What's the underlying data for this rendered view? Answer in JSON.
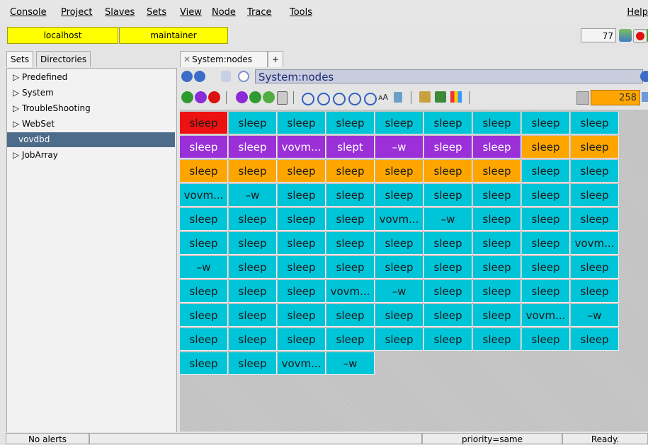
{
  "menu": {
    "items": [
      "Console",
      "Project",
      "Slaves",
      "Sets",
      "View",
      "Node",
      "Trace",
      "Tools"
    ],
    "help": "Help"
  },
  "infobar": {
    "host": "localhost",
    "user": "maintainer",
    "count": "77",
    "icons": [
      "monitor-icon",
      "stop-icon",
      "train-icon"
    ]
  },
  "left_panel": {
    "tabs": [
      "Sets",
      "Directories"
    ],
    "active_tab": "Sets",
    "tree": [
      {
        "label": "▷ Predefined",
        "selected": false
      },
      {
        "label": "▷ System",
        "selected": false
      },
      {
        "label": "▷ TroubleShooting",
        "selected": false
      },
      {
        "label": "▷ WebSet",
        "selected": false
      },
      {
        "label": "vovdbd",
        "selected": true
      },
      {
        "label": "▷ JobArray",
        "selected": false
      }
    ]
  },
  "right_panel": {
    "tab_close": "✕",
    "tab_label": "System:nodes",
    "tab_add": "+",
    "path": "System:nodes",
    "node_count": "258"
  },
  "colors": {
    "red": "#ee1111",
    "purple": "#9b30d9",
    "orange": "#ffa500",
    "cyan": "#00c4d8"
  },
  "grid": {
    "columns": 9,
    "cells": [
      {
        "text": "sleep",
        "color": "red"
      },
      {
        "text": "sleep",
        "color": "cyan"
      },
      {
        "text": "sleep",
        "color": "cyan"
      },
      {
        "text": "sleep",
        "color": "cyan"
      },
      {
        "text": "sleep",
        "color": "cyan"
      },
      {
        "text": "sleep",
        "color": "cyan"
      },
      {
        "text": "sleep",
        "color": "cyan"
      },
      {
        "text": "sleep",
        "color": "cyan"
      },
      {
        "text": "sleep",
        "color": "cyan"
      },
      {
        "text": "sleep",
        "color": "purple"
      },
      {
        "text": "sleep",
        "color": "purple"
      },
      {
        "text": "vovm...",
        "color": "purple"
      },
      {
        "text": "slept",
        "color": "purple"
      },
      {
        "text": "–w",
        "color": "purple"
      },
      {
        "text": "sleep",
        "color": "purple"
      },
      {
        "text": "sleep",
        "color": "purple"
      },
      {
        "text": "sleep",
        "color": "orange"
      },
      {
        "text": "sleep",
        "color": "orange"
      },
      {
        "text": "sleep",
        "color": "orange"
      },
      {
        "text": "sleep",
        "color": "orange"
      },
      {
        "text": "sleep",
        "color": "orange"
      },
      {
        "text": "sleep",
        "color": "orange"
      },
      {
        "text": "sleep",
        "color": "orange"
      },
      {
        "text": "sleep",
        "color": "orange"
      },
      {
        "text": "sleep",
        "color": "orange"
      },
      {
        "text": "sleep",
        "color": "cyan"
      },
      {
        "text": "sleep",
        "color": "cyan"
      },
      {
        "text": "vovm...",
        "color": "cyan"
      },
      {
        "text": "–w",
        "color": "cyan"
      },
      {
        "text": "sleep",
        "color": "cyan"
      },
      {
        "text": "sleep",
        "color": "cyan"
      },
      {
        "text": "sleep",
        "color": "cyan"
      },
      {
        "text": "sleep",
        "color": "cyan"
      },
      {
        "text": "sleep",
        "color": "cyan"
      },
      {
        "text": "sleep",
        "color": "cyan"
      },
      {
        "text": "sleep",
        "color": "cyan"
      },
      {
        "text": "sleep",
        "color": "cyan"
      },
      {
        "text": "sleep",
        "color": "cyan"
      },
      {
        "text": "sleep",
        "color": "cyan"
      },
      {
        "text": "sleep",
        "color": "cyan"
      },
      {
        "text": "vovm...",
        "color": "cyan"
      },
      {
        "text": "–w",
        "color": "cyan"
      },
      {
        "text": "sleep",
        "color": "cyan"
      },
      {
        "text": "sleep",
        "color": "cyan"
      },
      {
        "text": "sleep",
        "color": "cyan"
      },
      {
        "text": "sleep",
        "color": "cyan"
      },
      {
        "text": "sleep",
        "color": "cyan"
      },
      {
        "text": "sleep",
        "color": "cyan"
      },
      {
        "text": "sleep",
        "color": "cyan"
      },
      {
        "text": "sleep",
        "color": "cyan"
      },
      {
        "text": "sleep",
        "color": "cyan"
      },
      {
        "text": "sleep",
        "color": "cyan"
      },
      {
        "text": "sleep",
        "color": "cyan"
      },
      {
        "text": "vovm...",
        "color": "cyan"
      },
      {
        "text": "–w",
        "color": "cyan"
      },
      {
        "text": "sleep",
        "color": "cyan"
      },
      {
        "text": "sleep",
        "color": "cyan"
      },
      {
        "text": "sleep",
        "color": "cyan"
      },
      {
        "text": "sleep",
        "color": "cyan"
      },
      {
        "text": "sleep",
        "color": "cyan"
      },
      {
        "text": "sleep",
        "color": "cyan"
      },
      {
        "text": "sleep",
        "color": "cyan"
      },
      {
        "text": "sleep",
        "color": "cyan"
      },
      {
        "text": "sleep",
        "color": "cyan"
      },
      {
        "text": "sleep",
        "color": "cyan"
      },
      {
        "text": "sleep",
        "color": "cyan"
      },
      {
        "text": "vovm...",
        "color": "cyan"
      },
      {
        "text": "–w",
        "color": "cyan"
      },
      {
        "text": "sleep",
        "color": "cyan"
      },
      {
        "text": "sleep",
        "color": "cyan"
      },
      {
        "text": "sleep",
        "color": "cyan"
      },
      {
        "text": "sleep",
        "color": "cyan"
      },
      {
        "text": "sleep",
        "color": "cyan"
      },
      {
        "text": "sleep",
        "color": "cyan"
      },
      {
        "text": "sleep",
        "color": "cyan"
      },
      {
        "text": "sleep",
        "color": "cyan"
      },
      {
        "text": "sleep",
        "color": "cyan"
      },
      {
        "text": "sleep",
        "color": "cyan"
      },
      {
        "text": "sleep",
        "color": "cyan"
      },
      {
        "text": "vovm...",
        "color": "cyan"
      },
      {
        "text": "–w",
        "color": "cyan"
      },
      {
        "text": "sleep",
        "color": "cyan"
      },
      {
        "text": "sleep",
        "color": "cyan"
      },
      {
        "text": "sleep",
        "color": "cyan"
      },
      {
        "text": "sleep",
        "color": "cyan"
      },
      {
        "text": "sleep",
        "color": "cyan"
      },
      {
        "text": "sleep",
        "color": "cyan"
      },
      {
        "text": "sleep",
        "color": "cyan"
      },
      {
        "text": "sleep",
        "color": "cyan"
      },
      {
        "text": "sleep",
        "color": "cyan"
      },
      {
        "text": "sleep",
        "color": "cyan"
      },
      {
        "text": "sleep",
        "color": "cyan"
      },
      {
        "text": "vovm...",
        "color": "cyan"
      },
      {
        "text": "–w",
        "color": "cyan"
      }
    ]
  },
  "status": {
    "alerts": "No alerts",
    "priority": "priority=same",
    "state": "Ready."
  }
}
